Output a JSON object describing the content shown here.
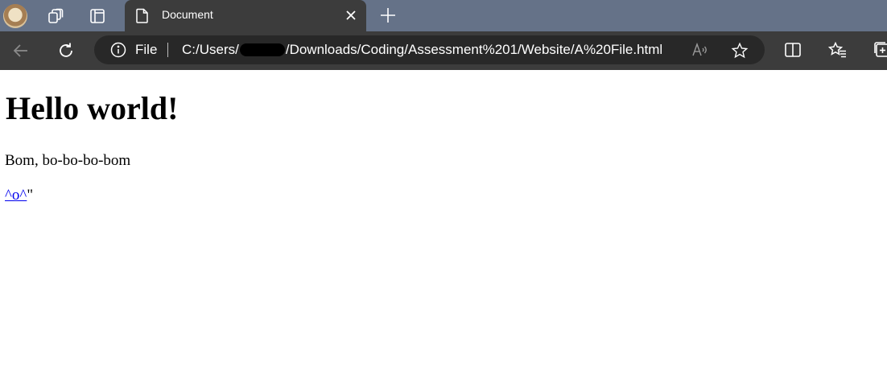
{
  "browser": {
    "tab": {
      "title": "Document"
    },
    "address_bar": {
      "scheme_label": "File",
      "url_prefix": "C:/Users/",
      "url_suffix": "/Downloads/Coding/Assessment%201/Website/A%20File.html"
    }
  },
  "page": {
    "heading": "Hello world!",
    "paragraph": "Bom, bo-bo-bo-bom",
    "link_text": "^o^",
    "after_link_text": "\""
  },
  "colors": {
    "tabbar_bg": "#657288",
    "toolbar_bg": "#3c3c3c",
    "omnibox_bg": "#282828",
    "link": "#0000ee"
  },
  "icons": {
    "profile": "profile-avatar",
    "workspaces": "workspaces-icon",
    "tab_actions": "tab-actions-icon",
    "tab_page": "document-icon",
    "tab_close": "close-icon",
    "new_tab": "plus-icon",
    "back": "back-arrow-icon",
    "refresh": "refresh-icon",
    "site_info": "info-icon",
    "read_aloud": "read-aloud-icon",
    "favorite": "star-icon",
    "split_screen": "split-screen-icon",
    "favorites": "favorites-icon",
    "collections": "collections-icon"
  }
}
